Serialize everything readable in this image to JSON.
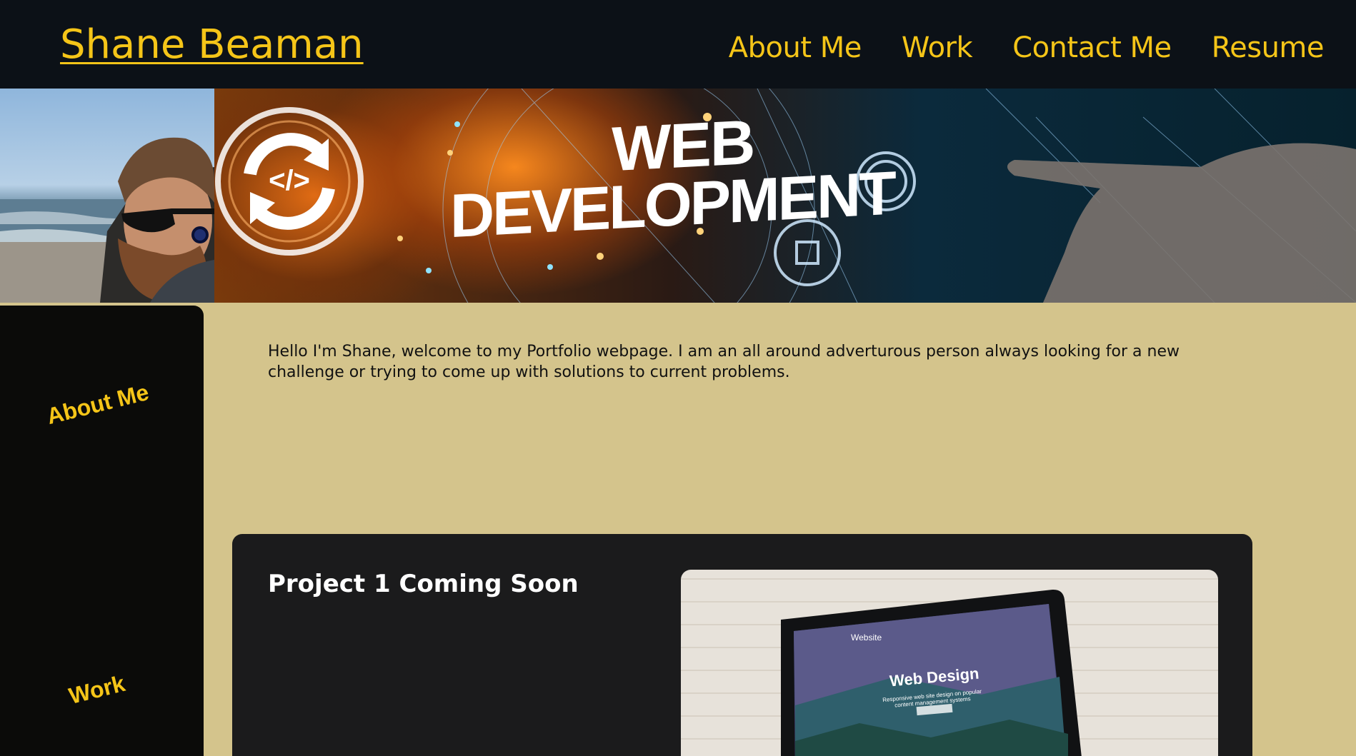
{
  "header": {
    "site_title": "Shane Beaman",
    "nav": [
      {
        "label": "About Me"
      },
      {
        "label": "Work"
      },
      {
        "label": "Contact Me"
      },
      {
        "label": "Resume"
      }
    ]
  },
  "banner": {
    "headline_line1": "WEB",
    "headline_line2": "DEVELOPMENT",
    "code_glyph": "</>"
  },
  "sidebar": {
    "items": [
      {
        "label": "About Me"
      },
      {
        "label": "Work"
      }
    ]
  },
  "intro": {
    "text": "Hello I'm Shane, welcome to my Portfolio webpage. I am an all around adverturous person always looking for a new challenge or trying to come up with solutions to current problems."
  },
  "project": {
    "title": "Project 1 Coming Soon",
    "screen_site_label": "Website",
    "screen_heading": "Web Design",
    "screen_subtext": "Responsive web site design on popular content management systems"
  },
  "colors": {
    "header_bg": "#0c1117",
    "accent": "#f5c518",
    "page_bg": "#d4c48c",
    "card_bg": "#1b1b1c"
  }
}
